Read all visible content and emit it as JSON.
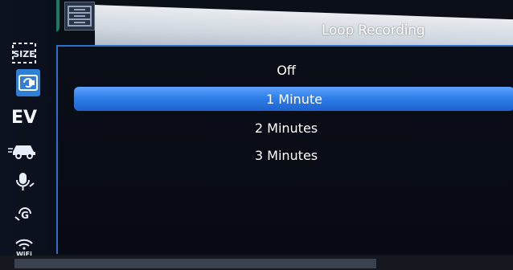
{
  "title": "Loop Recording",
  "options": [
    {
      "label": "Off",
      "selected": false
    },
    {
      "label": "1 Minute",
      "selected": true
    },
    {
      "label": "2 Minutes",
      "selected": false
    },
    {
      "label": "3 Minutes",
      "selected": false
    }
  ],
  "sidebar": {
    "items": [
      {
        "icon": "size-icon",
        "text": "SIZE"
      },
      {
        "icon": "loop-recording-icon",
        "text": ""
      },
      {
        "icon": "exposure-icon",
        "text": "EV"
      },
      {
        "icon": "car-icon",
        "text": ""
      },
      {
        "icon": "microphone-icon",
        "text": ""
      },
      {
        "icon": "gsensor-icon",
        "text": "G"
      },
      {
        "icon": "wifi-icon",
        "text": "WiFi"
      }
    ]
  },
  "colors": {
    "accent": "#2f7fe9",
    "tab_active": "#1e7a66",
    "panel_border": "#2d6fc8"
  }
}
